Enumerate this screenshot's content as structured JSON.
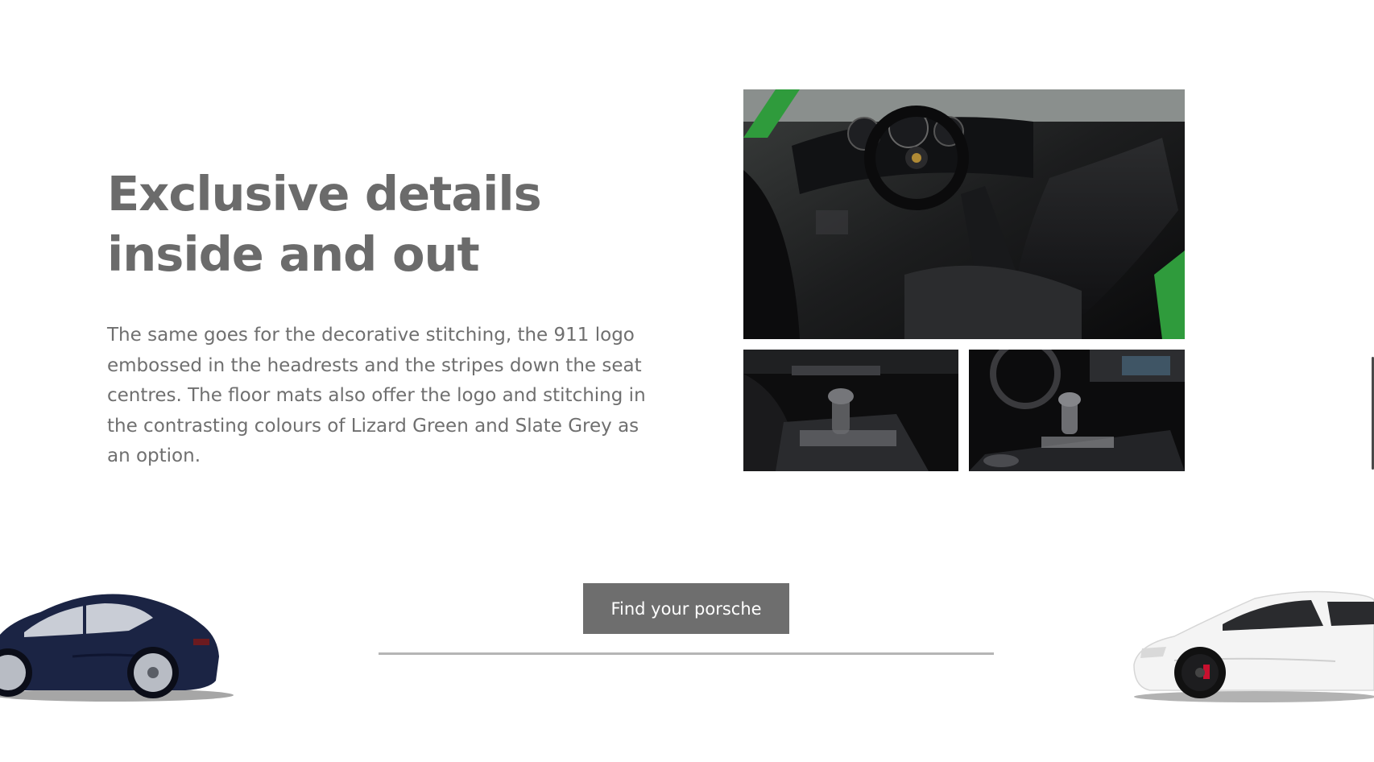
{
  "section": {
    "heading_lines": [
      "Exclusive details",
      "inside and out"
    ],
    "body_lines": [
      "The same goes for the decorative stitching, the 911 logo",
      "embossed in the headrests and the stripes down the seat",
      "centres. The floor mats also offer the logo and stitching in",
      "the contrasting colours of Lizard Green and Slate Grey as",
      "an option."
    ]
  },
  "gallery": {
    "main_image": "interior-cockpit-photo",
    "small_left_image": "gear-shifter-manual-photo",
    "small_right_image": "gear-selector-pdk-photo"
  },
  "cta": {
    "label": "Find your porsche"
  },
  "cars": {
    "left": "dark-blue-sports-car",
    "right": "white-sports-car"
  },
  "colors": {
    "heading": "#6b6b6b",
    "body": "#6f6f6f",
    "button_bg": "#6e6e6e",
    "button_text": "#ffffff",
    "divider": "#b5b5b5",
    "accent_green": "#2f9b3c",
    "car_left_body": "#1b2444",
    "car_right_body": "#f4f4f4"
  }
}
